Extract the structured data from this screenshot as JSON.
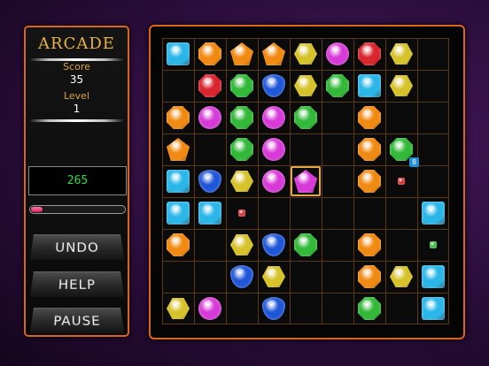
{
  "panel": {
    "title": "ARCADE",
    "score_label": "Score",
    "score": "35",
    "level_label": "Level",
    "level": "1",
    "timer": "265",
    "progress": 0.12
  },
  "buttons": {
    "undo": "UNDO",
    "help": "HELP",
    "pause": "PAUSE"
  },
  "colors": {
    "blue": "#2bb6e8",
    "orange": "#f08a12",
    "yellow": "#d6c22a",
    "pink": "#d83ad8",
    "red": "#d8252e",
    "green": "#33b83a",
    "navy": "#1f57d8",
    "border": "#d8661c"
  },
  "board": {
    "cols": 9,
    "rows": 9,
    "cells": [
      {
        "c": 0,
        "r": 0,
        "color": "blue",
        "shape": "square"
      },
      {
        "c": 1,
        "r": 0,
        "color": "orange",
        "shape": "octagon"
      },
      {
        "c": 2,
        "r": 0,
        "color": "orange",
        "shape": "pentagon"
      },
      {
        "c": 3,
        "r": 0,
        "color": "orange",
        "shape": "pentagon"
      },
      {
        "c": 4,
        "r": 0,
        "color": "yellow",
        "shape": "hexagon"
      },
      {
        "c": 5,
        "r": 0,
        "color": "pink",
        "shape": "round"
      },
      {
        "c": 6,
        "r": 0,
        "color": "red",
        "shape": "octagon"
      },
      {
        "c": 7,
        "r": 0,
        "color": "yellow",
        "shape": "hexagon"
      },
      {
        "c": 1,
        "r": 1,
        "color": "red",
        "shape": "octagon"
      },
      {
        "c": 2,
        "r": 1,
        "color": "green",
        "shape": "octagon"
      },
      {
        "c": 3,
        "r": 1,
        "color": "navy",
        "shape": "shield"
      },
      {
        "c": 4,
        "r": 1,
        "color": "yellow",
        "shape": "hexagon"
      },
      {
        "c": 5,
        "r": 1,
        "color": "green",
        "shape": "octagon"
      },
      {
        "c": 6,
        "r": 1,
        "color": "blue",
        "shape": "square"
      },
      {
        "c": 7,
        "r": 1,
        "color": "yellow",
        "shape": "hexagon"
      },
      {
        "c": 0,
        "r": 2,
        "color": "orange",
        "shape": "octagon"
      },
      {
        "c": 1,
        "r": 2,
        "color": "pink",
        "shape": "round"
      },
      {
        "c": 2,
        "r": 2,
        "color": "green",
        "shape": "octagon"
      },
      {
        "c": 3,
        "r": 2,
        "color": "pink",
        "shape": "round"
      },
      {
        "c": 4,
        "r": 2,
        "color": "green",
        "shape": "octagon"
      },
      {
        "c": 6,
        "r": 2,
        "color": "orange",
        "shape": "octagon"
      },
      {
        "c": 0,
        "r": 3,
        "color": "orange",
        "shape": "pentagon"
      },
      {
        "c": 2,
        "r": 3,
        "color": "green",
        "shape": "octagon"
      },
      {
        "c": 3,
        "r": 3,
        "color": "pink",
        "shape": "round"
      },
      {
        "c": 6,
        "r": 3,
        "color": "orange",
        "shape": "octagon"
      },
      {
        "c": 7,
        "r": 3,
        "color": "green",
        "shape": "octagon",
        "badge": "8"
      },
      {
        "c": 0,
        "r": 4,
        "color": "blue",
        "shape": "square"
      },
      {
        "c": 1,
        "r": 4,
        "color": "navy",
        "shape": "shield"
      },
      {
        "c": 2,
        "r": 4,
        "color": "yellow",
        "shape": "hexagon"
      },
      {
        "c": 3,
        "r": 4,
        "color": "pink",
        "shape": "round"
      },
      {
        "c": 4,
        "r": 4,
        "color": "pink",
        "shape": "pentagon",
        "selected": true
      },
      {
        "c": 6,
        "r": 4,
        "color": "orange",
        "shape": "octagon"
      },
      {
        "c": 7,
        "r": 4,
        "color": "red",
        "shape": "small"
      },
      {
        "c": 0,
        "r": 5,
        "color": "blue",
        "shape": "square"
      },
      {
        "c": 1,
        "r": 5,
        "color": "blue",
        "shape": "square"
      },
      {
        "c": 2,
        "r": 5,
        "color": "red",
        "shape": "small"
      },
      {
        "c": 8,
        "r": 5,
        "color": "blue",
        "shape": "square"
      },
      {
        "c": 0,
        "r": 6,
        "color": "orange",
        "shape": "octagon"
      },
      {
        "c": 2,
        "r": 6,
        "color": "yellow",
        "shape": "hexagon"
      },
      {
        "c": 3,
        "r": 6,
        "color": "navy",
        "shape": "shield"
      },
      {
        "c": 4,
        "r": 6,
        "color": "green",
        "shape": "octagon"
      },
      {
        "c": 6,
        "r": 6,
        "color": "orange",
        "shape": "octagon"
      },
      {
        "c": 8,
        "r": 6,
        "color": "green",
        "shape": "small"
      },
      {
        "c": 2,
        "r": 7,
        "color": "navy",
        "shape": "shield"
      },
      {
        "c": 3,
        "r": 7,
        "color": "yellow",
        "shape": "hexagon"
      },
      {
        "c": 6,
        "r": 7,
        "color": "orange",
        "shape": "octagon"
      },
      {
        "c": 7,
        "r": 7,
        "color": "yellow",
        "shape": "hexagon"
      },
      {
        "c": 8,
        "r": 7,
        "color": "blue",
        "shape": "square"
      },
      {
        "c": 0,
        "r": 8,
        "color": "yellow",
        "shape": "hexagon"
      },
      {
        "c": 1,
        "r": 8,
        "color": "pink",
        "shape": "round"
      },
      {
        "c": 3,
        "r": 8,
        "color": "navy",
        "shape": "shield"
      },
      {
        "c": 6,
        "r": 8,
        "color": "green",
        "shape": "octagon"
      },
      {
        "c": 8,
        "r": 8,
        "color": "blue",
        "shape": "square"
      }
    ]
  }
}
